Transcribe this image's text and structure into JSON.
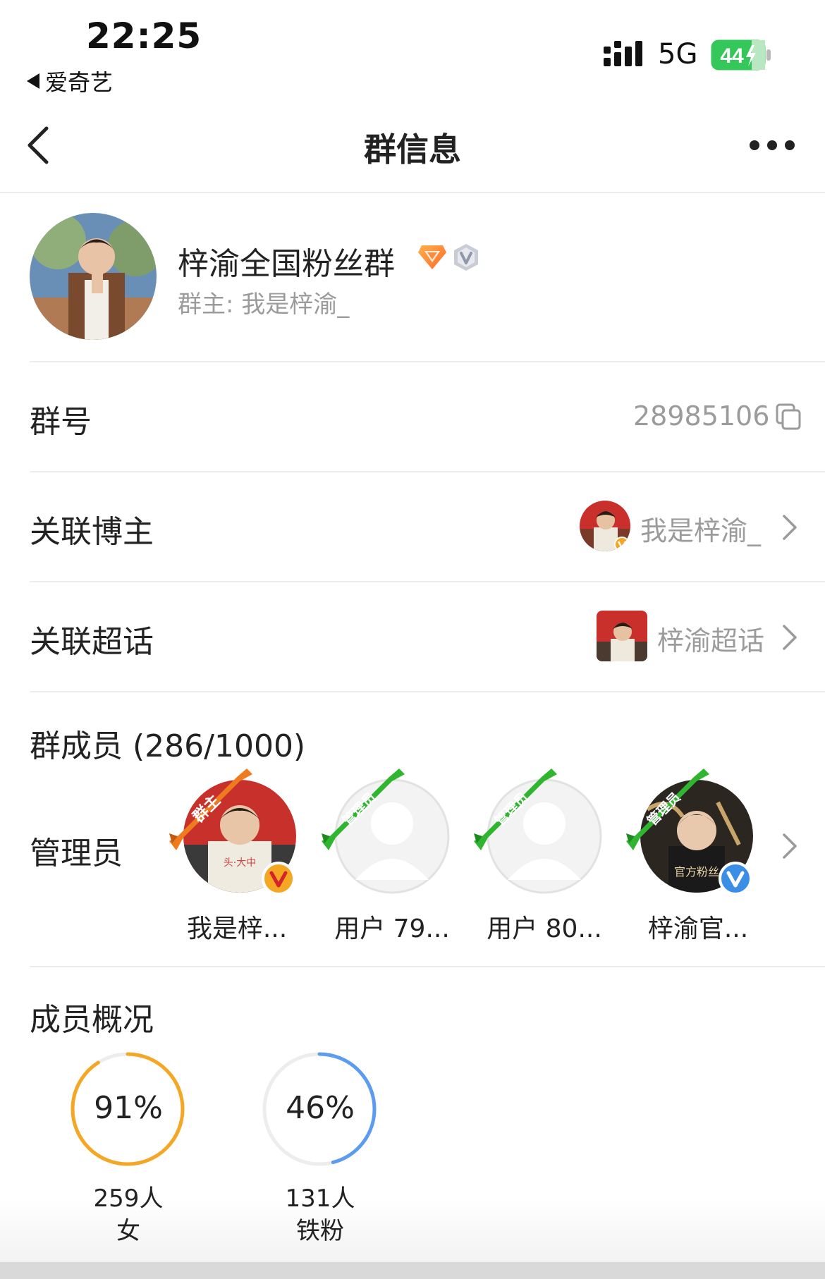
{
  "status_bar": {
    "time": "22:25",
    "back_app": "爱奇艺",
    "network": "5G",
    "battery": "44"
  },
  "nav": {
    "title": "群信息"
  },
  "group": {
    "name": "梓渝全国粉丝群",
    "owner": "群主: 我是梓渝_"
  },
  "rows": {
    "group_id_label": "群号",
    "group_id_value": "28985106",
    "blogger_label": "关联博主",
    "blogger_value": "我是梓渝_",
    "topic_label": "关联超话",
    "topic_value": "梓渝超话"
  },
  "members": {
    "title": "群成员 (286/1000)",
    "admin_label": "管理员",
    "admins": [
      {
        "name": "我是梓...",
        "ribbon": "群主",
        "ribbon_color": "#f07a1e",
        "verified": "orange"
      },
      {
        "name": "用户 79...",
        "ribbon": "管理员",
        "ribbon_color": "#2fb52f",
        "verified": ""
      },
      {
        "name": "用户 80...",
        "ribbon": "管理员",
        "ribbon_color": "#2fb52f",
        "verified": ""
      },
      {
        "name": "梓渝官...",
        "ribbon": "管理员",
        "ribbon_color": "#2fb52f",
        "verified": "blue"
      }
    ]
  },
  "overview": {
    "title": "成员概况",
    "stats": [
      {
        "percent": "91%",
        "fraction": 0.91,
        "count": "259人",
        "label": "女",
        "color": "#f5a623"
      },
      {
        "percent": "46%",
        "fraction": 0.46,
        "count": "131人",
        "label": "铁粉",
        "color": "#5b9cf0"
      }
    ]
  },
  "colors": {
    "accent_orange": "#f5a623",
    "accent_blue": "#5b9cf0",
    "owner_ribbon": "#f07a1e",
    "admin_ribbon": "#2fb52f"
  }
}
